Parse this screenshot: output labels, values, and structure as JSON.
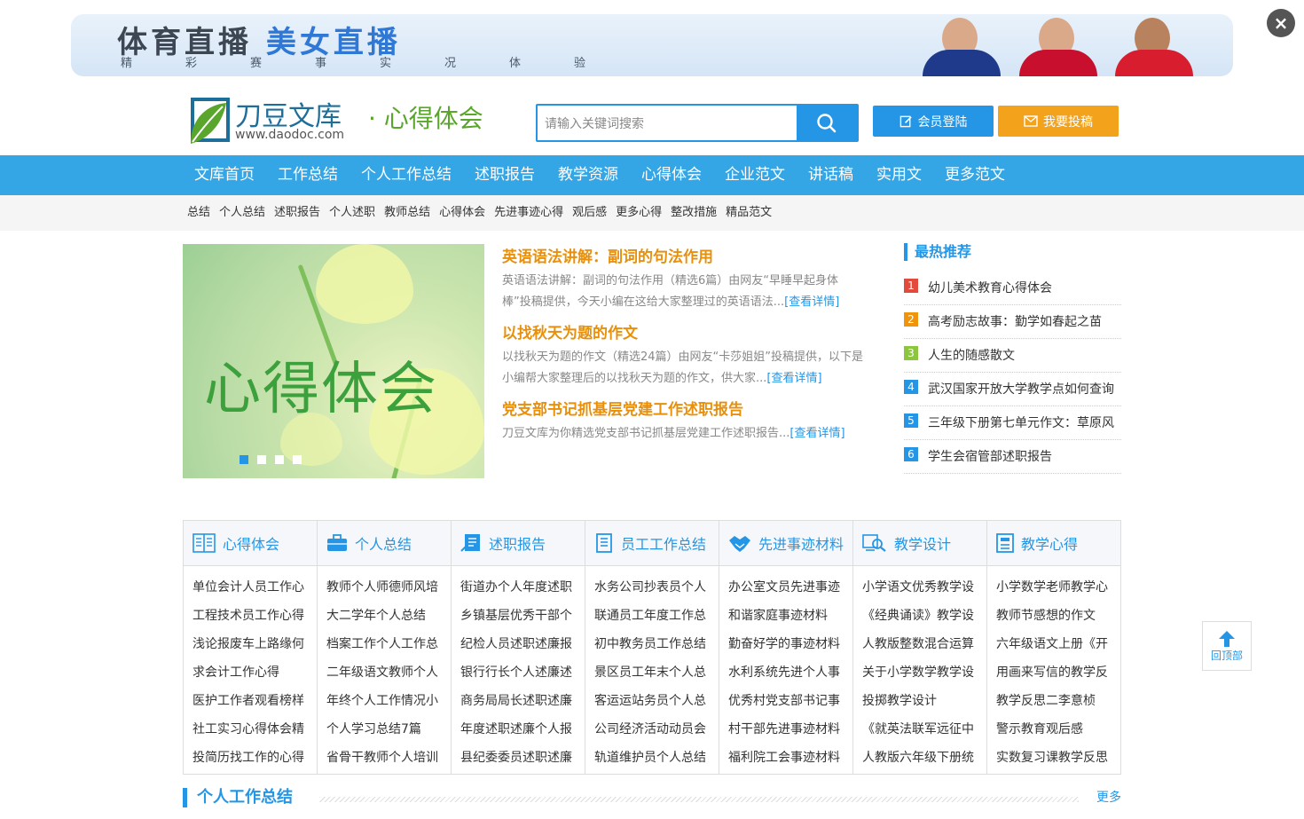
{
  "banner": {
    "title_part1": "体育直播",
    "title_part2": "美女直播",
    "subtitle": "精彩赛事实况体验",
    "close_label": "×"
  },
  "logo": {
    "name": "刀豆文库",
    "url": "www.daodoc.com",
    "section": "· 心得体会"
  },
  "search": {
    "placeholder": "请输入关键词搜索"
  },
  "header": {
    "login_label": "会员登陆",
    "submit_label": "我要投稿"
  },
  "mainnav": [
    "文库首页",
    "工作总结",
    "个人工作总结",
    "述职报告",
    "教学资源",
    "心得体会",
    "企业范文",
    "讲话稿",
    "实用文",
    "更多范文"
  ],
  "subnav": [
    "总结",
    "个人总结",
    "述职报告",
    "个人述职",
    "教师总结",
    "心得体会",
    "先进事迹心得",
    "观后感",
    "更多心得",
    "整改措施",
    "精品范文"
  ],
  "slider": {
    "title": "心得体会"
  },
  "articles": [
    {
      "title": "英语语法讲解：副词的句法作用",
      "summary": "英语语法讲解：副词的句法作用（精选6篇）由网友“早睡早起身体棒”投稿提供，今天小编在这给大家整理过的英语语法...",
      "more": "[查看详情]"
    },
    {
      "title": "以找秋天为题的作文",
      "summary": "以找秋天为题的作文（精选24篇）由网友“卡莎姐姐”投稿提供，以下是小编帮大家整理后的以找秋天为题的作文，供大家...",
      "more": "[查看详情]"
    },
    {
      "title": "党支部书记抓基层党建工作述职报告",
      "summary": "刀豆文库为你精选党支部书记抓基层党建工作述职报告...",
      "more": "[查看详情]"
    }
  ],
  "hot": {
    "title": "最热推荐",
    "items": [
      {
        "num": "1",
        "text": "幼儿美术教育心得体会",
        "color": "#e24b3b"
      },
      {
        "num": "2",
        "text": "高考励志故事：勤学如春起之苗",
        "color": "#f0940c"
      },
      {
        "num": "3",
        "text": "人生的随感散文",
        "color": "#8cc63e"
      },
      {
        "num": "4",
        "text": "武汉国家开放大学教学点如何查询",
        "color": "#2596e5"
      },
      {
        "num": "5",
        "text": "三年级下册第七单元作文：草原风",
        "color": "#2596e5"
      },
      {
        "num": "6",
        "text": "学生会宿管部述职报告",
        "color": "#2596e5"
      }
    ]
  },
  "categories": [
    {
      "title": "心得体会",
      "icon": "book-icon",
      "items": [
        "单位会计人员工作心",
        "工程技术员工作心得",
        "浅论报废车上路缘何",
        "求会计工作心得",
        "医护工作者观看榜样",
        "社工实习心得体会精",
        "投简历找工作的心得"
      ]
    },
    {
      "title": "个人总结",
      "icon": "briefcase-icon",
      "items": [
        "教师个人师德师风培",
        "大二学年个人总结",
        "档案工作个人工作总",
        "二年级语文教师个人",
        "年终个人工作情况小",
        "个人学习总结7篇",
        "省骨干教师个人培训"
      ]
    },
    {
      "title": "述职报告",
      "icon": "report-icon",
      "items": [
        "街道办个人年度述职",
        "乡镇基层优秀干部个",
        "纪检人员述职述廉报",
        "银行行长个人述廉述",
        "商务局局长述职述廉",
        "年度述职述廉个人报",
        "县纪委委员述职述廉"
      ]
    },
    {
      "title": "员工工作总结",
      "icon": "document-icon",
      "items": [
        "水务公司抄表员个人",
        "联通员工年度工作总",
        "初中教务员工作总结",
        "景区员工年末个人总",
        "客运运站务员个人总",
        "公司经济活动动员会",
        "轨道维护员个人总结"
      ]
    },
    {
      "title": "先进事迹材料",
      "icon": "handshake-icon",
      "items": [
        "办公室文员先进事迹",
        "和谐家庭事迹材料",
        "勤奋好学的事迹材料",
        "水利系统先进个人事",
        "优秀村党支部书记事",
        "村干部先进事迹材料",
        "福利院工会事迹材料"
      ]
    },
    {
      "title": "教学设计",
      "icon": "search-doc-icon",
      "items": [
        "小学语文优秀教学设",
        "《经典诵读》教学设",
        "人教版整数混合运算",
        "关于小学数学教学设",
        "投掷教学设计",
        "《就英法联军远征中",
        "人教版六年级下册统"
      ]
    },
    {
      "title": "教学心得",
      "icon": "notebook-icon",
      "items": [
        "小学数学老师教学心",
        "教师节感想的作文",
        "六年级语文上册《开",
        "用画来写信的教学反",
        "教学反思二李意桢",
        "警示教育观后感",
        "实数复习课教学反思"
      ]
    }
  ],
  "section": {
    "title": "个人工作总结",
    "more": "更多"
  },
  "backtop": {
    "label": "回顶部"
  },
  "colors": {
    "accent": "#2596e5",
    "orange": "#f3a21b",
    "green": "#5aa52b"
  }
}
